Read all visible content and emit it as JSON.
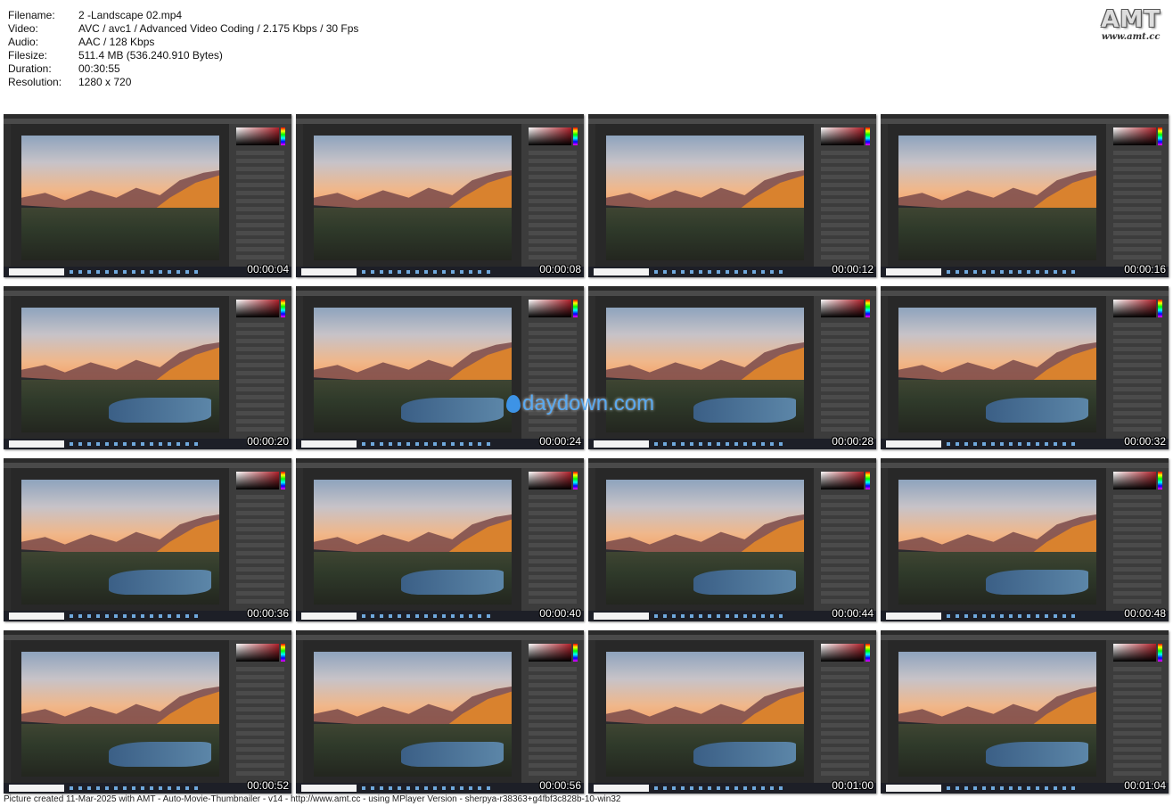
{
  "info": [
    {
      "label": "Filename:",
      "value": "2 -Landscape 02.mp4"
    },
    {
      "label": "Video:",
      "value": "AVC / avc1 / Advanced Video Coding / 2.175 Kbps / 30 Fps"
    },
    {
      "label": "Audio:",
      "value": "AAC / 128 Kbps"
    },
    {
      "label": "Filesize:",
      "value": "511.4 MB (536.240.910 Bytes)"
    },
    {
      "label": "Duration:",
      "value": "00:30:55"
    },
    {
      "label": "Resolution:",
      "value": "1280 x 720"
    }
  ],
  "logo": {
    "title": "AMT",
    "url": "www.amt.cc"
  },
  "thumbnails": [
    {
      "time": "00:00:04"
    },
    {
      "time": "00:00:08"
    },
    {
      "time": "00:00:12"
    },
    {
      "time": "00:00:16"
    },
    {
      "time": "00:00:20"
    },
    {
      "time": "00:00:24"
    },
    {
      "time": "00:00:28"
    },
    {
      "time": "00:00:32"
    },
    {
      "time": "00:00:36"
    },
    {
      "time": "00:00:40"
    },
    {
      "time": "00:00:44"
    },
    {
      "time": "00:00:48"
    },
    {
      "time": "00:00:52"
    },
    {
      "time": "00:00:56"
    },
    {
      "time": "00:01:00"
    },
    {
      "time": "00:01:04"
    }
  ],
  "watermark": "daydown.com",
  "footer": "Picture created 11-Mar-2025 with AMT - Auto-Movie-Thumbnailer - v14 - http://www.amt.cc - using MPlayer Version - sherpya-r38363+g4fbf3c828b-10-win32"
}
